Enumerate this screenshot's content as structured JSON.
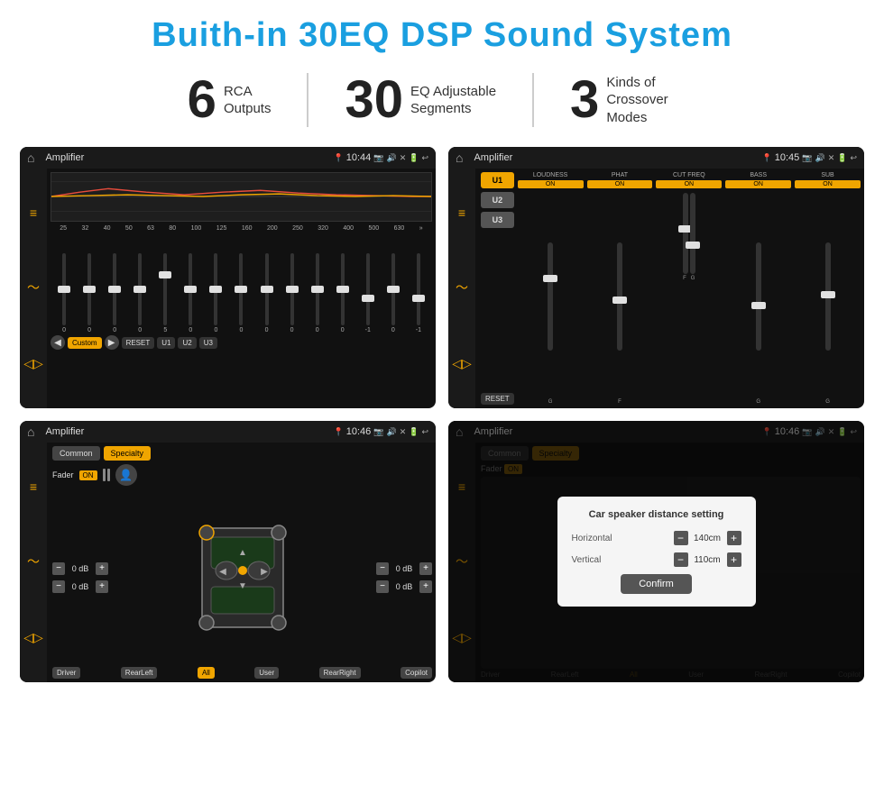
{
  "page": {
    "title": "Buith-in 30EQ DSP Sound System"
  },
  "stats": [
    {
      "number": "6",
      "label": "RCA\nOutputs"
    },
    {
      "number": "30",
      "label": "EQ Adjustable\nSegments"
    },
    {
      "number": "3",
      "label": "Kinds of\nCrossover Modes"
    }
  ],
  "screens": [
    {
      "id": "eq-screen",
      "status": {
        "title": "Amplifier",
        "time": "10:44"
      },
      "type": "equalizer"
    },
    {
      "id": "crossover-screen",
      "status": {
        "title": "Amplifier",
        "time": "10:45"
      },
      "type": "crossover"
    },
    {
      "id": "fader-screen",
      "status": {
        "title": "Amplifier",
        "time": "10:46"
      },
      "type": "fader"
    },
    {
      "id": "distance-screen",
      "status": {
        "title": "Amplifier",
        "time": "10:46"
      },
      "type": "distance",
      "dialog": {
        "title": "Car speaker distance setting",
        "horizontal_label": "Horizontal",
        "horizontal_value": "140cm",
        "vertical_label": "Vertical",
        "vertical_value": "110cm",
        "confirm_label": "Confirm"
      }
    }
  ],
  "eq": {
    "freqs": [
      "25",
      "32",
      "40",
      "50",
      "63",
      "80",
      "100",
      "125",
      "160",
      "200",
      "250",
      "320",
      "400",
      "500",
      "630"
    ],
    "values": [
      "0",
      "0",
      "0",
      "0",
      "5",
      "0",
      "0",
      "0",
      "0",
      "0",
      "0",
      "0",
      "-1",
      "0",
      "-1"
    ],
    "controls": [
      "Custom",
      "RESET",
      "U1",
      "U2",
      "U3"
    ]
  },
  "crossover": {
    "modes": [
      "U1",
      "U2",
      "U3"
    ],
    "channels": [
      {
        "label": "LOUDNESS",
        "toggle": "ON",
        "value": ""
      },
      {
        "label": "PHAT",
        "toggle": "ON",
        "value": ""
      },
      {
        "label": "CUT FREQ",
        "toggle": "ON",
        "value": ""
      },
      {
        "label": "BASS",
        "toggle": "ON",
        "value": ""
      },
      {
        "label": "SUB",
        "toggle": "ON",
        "value": ""
      }
    ]
  },
  "fader": {
    "tabs": [
      "Common",
      "Specialty"
    ],
    "fader_label": "Fader",
    "fader_toggle": "ON",
    "volumes": [
      "0 dB",
      "0 dB",
      "0 dB",
      "0 dB"
    ],
    "bottom_buttons": [
      "Driver",
      "RearLeft",
      "All",
      "User",
      "RearRight",
      "Copilot"
    ]
  },
  "distance_dialog": {
    "title": "Car speaker distance setting",
    "horizontal_label": "Horizontal",
    "horizontal_value": "140cm",
    "vertical_label": "Vertical",
    "vertical_value": "110cm",
    "confirm_label": "Confirm"
  }
}
